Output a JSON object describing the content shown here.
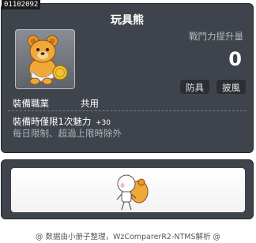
{
  "item": {
    "id": "01102092",
    "name": "玩具熊",
    "stat_label": "戰鬥力提升量",
    "stat_value": "0",
    "tags": [
      "防具",
      "披風"
    ],
    "job_label": "裝備職業",
    "job_value": "共用",
    "equip_text": "裝備時僅限1次魅力",
    "equip_bonus": "+30",
    "limit_text": "每日限制、超過上限時除外"
  },
  "preview": {
    "icon": "character-with-teddy-bear"
  },
  "footer": {
    "text": "@ 数据由小册子整理，WzComparerR2-NTMS解析 @"
  },
  "colors": {
    "panel": "#3f444c",
    "panel_border": "#22262b",
    "text": "#ffffff",
    "muted": "#b5b9be",
    "tag_bg": "#2b2f34"
  }
}
